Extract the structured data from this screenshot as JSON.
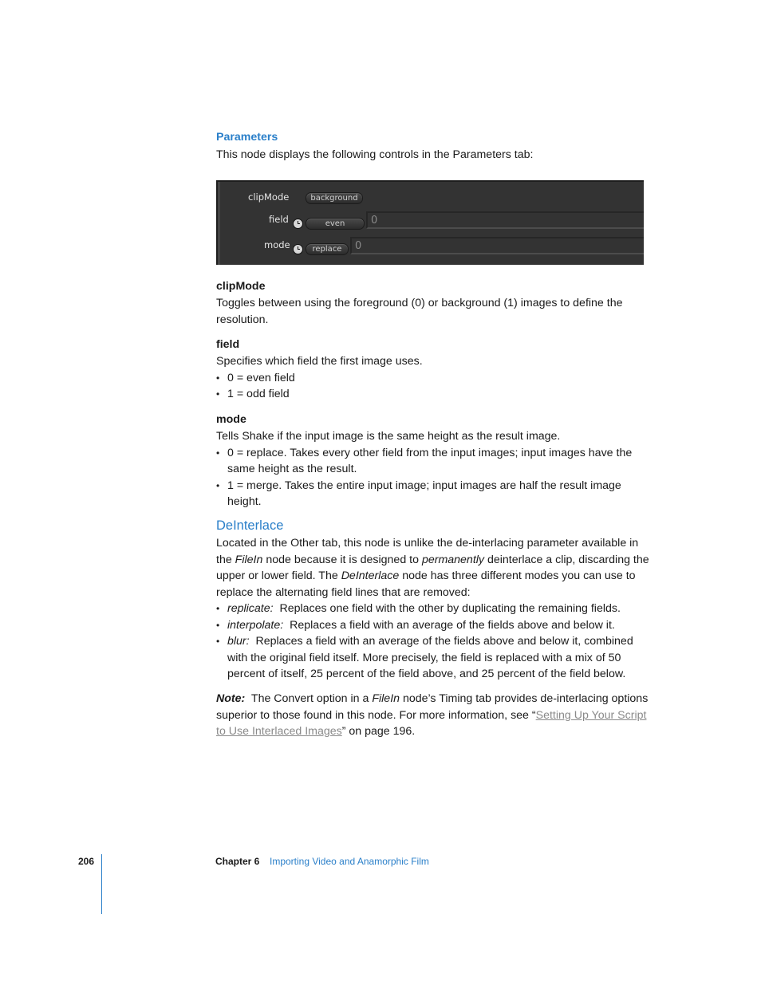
{
  "parameters_section": {
    "heading": "Parameters",
    "intro": "This node displays the following controls in the Parameters tab:"
  },
  "panel": {
    "rows": [
      {
        "label": "clipMode",
        "button": "background",
        "has_clock": false,
        "value": null
      },
      {
        "label": "field",
        "button": "even",
        "has_clock": true,
        "value": "0"
      },
      {
        "label": "mode",
        "button": "replace",
        "has_clock": true,
        "value": "0"
      }
    ]
  },
  "params": [
    {
      "name": "clipMode",
      "lines": [
        "Toggles between using the foreground (0) or background (1) images to define the",
        "resolution."
      ],
      "bullets": []
    },
    {
      "name": "field",
      "lines": [
        "Specifies which field the first image uses."
      ],
      "bullets": [
        [
          "0 = even field"
        ],
        [
          "1 = odd field"
        ]
      ]
    },
    {
      "name": "mode",
      "lines": [
        "Tells Shake if the input image is the same height as the result image."
      ],
      "bullets": [
        [
          "0 = replace. Takes every other field from the input images; input images have the",
          "same height as the result."
        ],
        [
          "1 = merge. Takes the entire input image; input images are half the result image",
          "height."
        ]
      ]
    }
  ],
  "deinterlace": {
    "heading": "DeInterlace",
    "para": {
      "l1": "Located in the Other tab, this node is unlike the de-interlacing parameter available in",
      "l2_a": "the ",
      "l2_em1": "FileIn",
      "l2_b": " node because it is designed to ",
      "l2_em2": "permanently",
      "l2_c": " deinterlace a clip, discarding the",
      "l3_a": "upper or lower field. The ",
      "l3_em": "DeInterlace",
      "l3_b": " node has three different modes you can use to",
      "l4": "replace the alternating field lines that are removed:"
    },
    "modes": [
      {
        "term": "replicate:",
        "lines": [
          "Replaces one field with the other by duplicating the remaining fields."
        ]
      },
      {
        "term": "interpolate:",
        "lines": [
          "Replaces a field with an average of the fields above and below it."
        ]
      },
      {
        "term": "blur:",
        "lines": [
          "Replaces a field with an average of the fields above and below it, combined",
          "with the original field itself. More precisely, the field is replaced with a mix of 50",
          "percent of itself, 25 percent of the field above, and 25 percent of the field below."
        ]
      }
    ],
    "note": {
      "label": "Note:",
      "l1_a": "The Convert option in a ",
      "l1_em": "FileIn",
      "l1_b": " node’s Timing tab provides de-interlacing options",
      "l2_a": "superior to those found in this node. For more information, see “",
      "link_1": "Setting Up Your Script ",
      "link_2": "to Use Interlaced Images",
      "l3_b": "” on page 196."
    }
  },
  "footer": {
    "page_number": "206",
    "chapter": "Chapter 6",
    "chapter_title": "Importing Video and Anamorphic Film"
  },
  "bullet_char": "•"
}
